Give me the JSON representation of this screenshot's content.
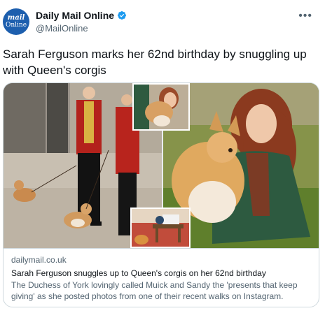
{
  "author": {
    "avatar_lines": [
      "mail",
      "Online"
    ],
    "name": "Daily Mail Online",
    "handle": "@MailOnline",
    "verified_icon": "verified-badge-icon",
    "menu_icon": "more-icon"
  },
  "tweet": {
    "text": "Sarah Ferguson marks her 62nd birthday by snuggling up with Queen's corgis"
  },
  "card": {
    "domain": "dailymail.co.uk",
    "title": "Sarah Ferguson snuggles up to Queen's corgis on her 62nd birthday",
    "description": "The Duchess of York lovingly called Muick and Sandy the 'presents that keep giving' as she posted photos from one of their recent walks on Instagram."
  },
  "colors": {
    "brand_blue": "#1d5fae",
    "verified_blue": "#1d9bf0",
    "text_primary": "#0f1419",
    "text_secondary": "#536471",
    "border": "#cfd9de"
  }
}
